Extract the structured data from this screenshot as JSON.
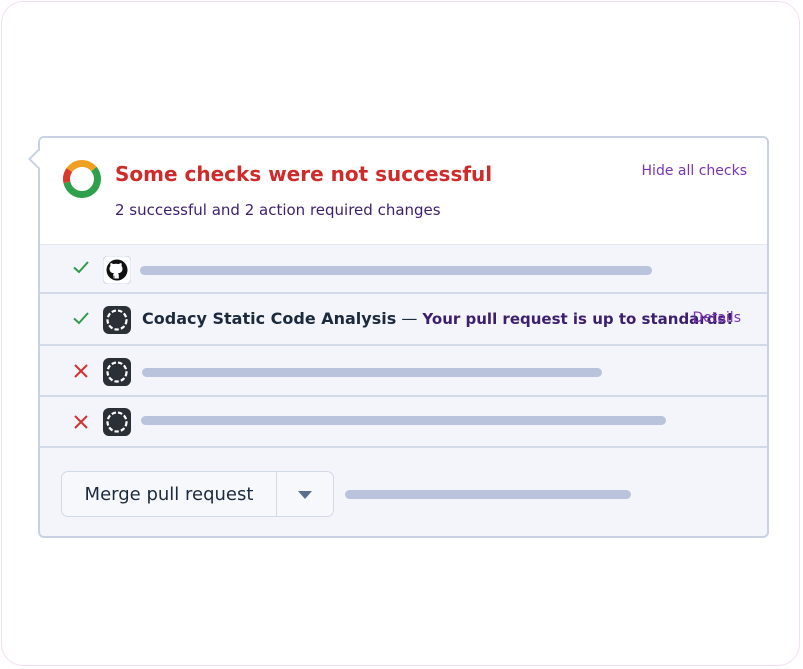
{
  "checks_panel": {
    "title": "Some checks were not successful",
    "subtitle": "2 successful and 2 action required changes",
    "hide_label": "Hide all checks",
    "colors": {
      "title": "#cf2b2b",
      "success": "#2f9a4a",
      "failure": "#d13333",
      "donut_green": "#2fa04b",
      "donut_orange": "#f0a020",
      "donut_red": "#d93a2c"
    },
    "checks": [
      {
        "status": "success",
        "status_icon": "check-icon",
        "app_icon": "github-icon"
      },
      {
        "status": "success",
        "status_icon": "check-icon",
        "app_icon": "codacy-icon",
        "name": "Codacy Static Code Analysis",
        "separator": " — ",
        "description": "Your pull request is up to standards!",
        "details_label": "Details"
      },
      {
        "status": "failure",
        "status_icon": "x-icon",
        "app_icon": "codacy-icon"
      },
      {
        "status": "failure",
        "status_icon": "x-icon",
        "app_icon": "codacy-icon"
      }
    ]
  },
  "merge": {
    "button_label": "Merge pull request",
    "dropdown_icon": "caret-down-icon"
  }
}
